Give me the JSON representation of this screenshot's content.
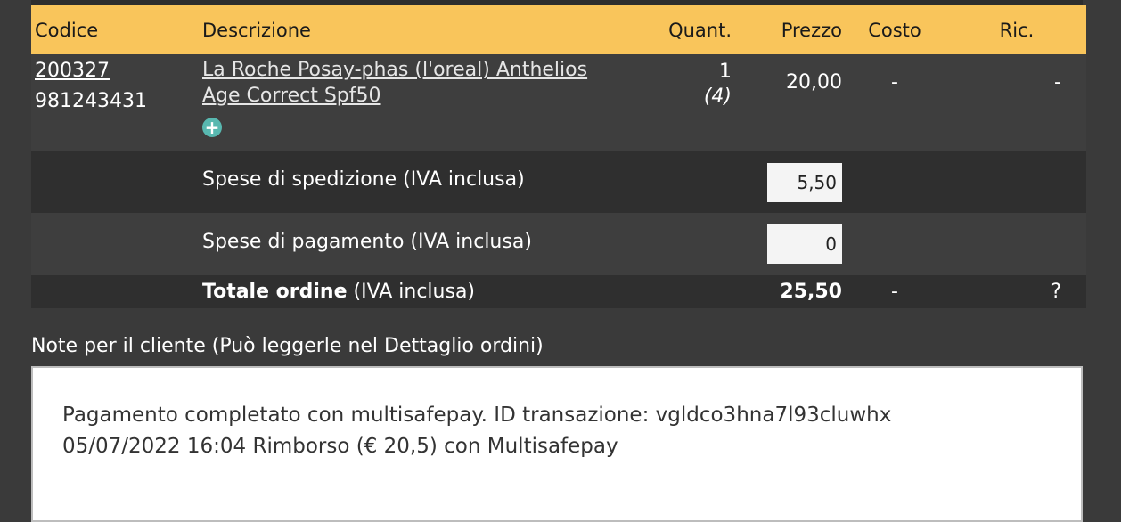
{
  "table": {
    "headers": {
      "code": "Codice",
      "description": "Descrizione",
      "quantity": "Quant.",
      "price": "Prezzo",
      "cost": "Costo",
      "markup": "Ric."
    },
    "product": {
      "code": "200327",
      "barcode": "981243431",
      "description_line1": "La Roche Posay-phas (l'oreal) Anthelios",
      "description_line2": "Age Correct Spf50",
      "quantity": "1",
      "stock": "(4)",
      "price": "20,00",
      "cost": "-",
      "markup": "-"
    },
    "shipping": {
      "label": "Spese di spedizione (IVA inclusa)",
      "value": "5,50"
    },
    "payment": {
      "label": "Spese di pagamento (IVA inclusa)",
      "value": "0"
    },
    "total": {
      "label_bold": "Totale ordine",
      "label_rest": " (IVA inclusa)",
      "price": "25,50",
      "cost": "-",
      "markup": "?"
    }
  },
  "notes": {
    "label": "Note per il cliente (Può leggerle nel Dettaglio ordini)",
    "line1": "Pagamento completato con multisafepay. ID transazione: vgldco3hna7l93cluwhx",
    "line2": "05/07/2022 16:04 Rimborso (€ 20,5) con Multisafepay"
  }
}
